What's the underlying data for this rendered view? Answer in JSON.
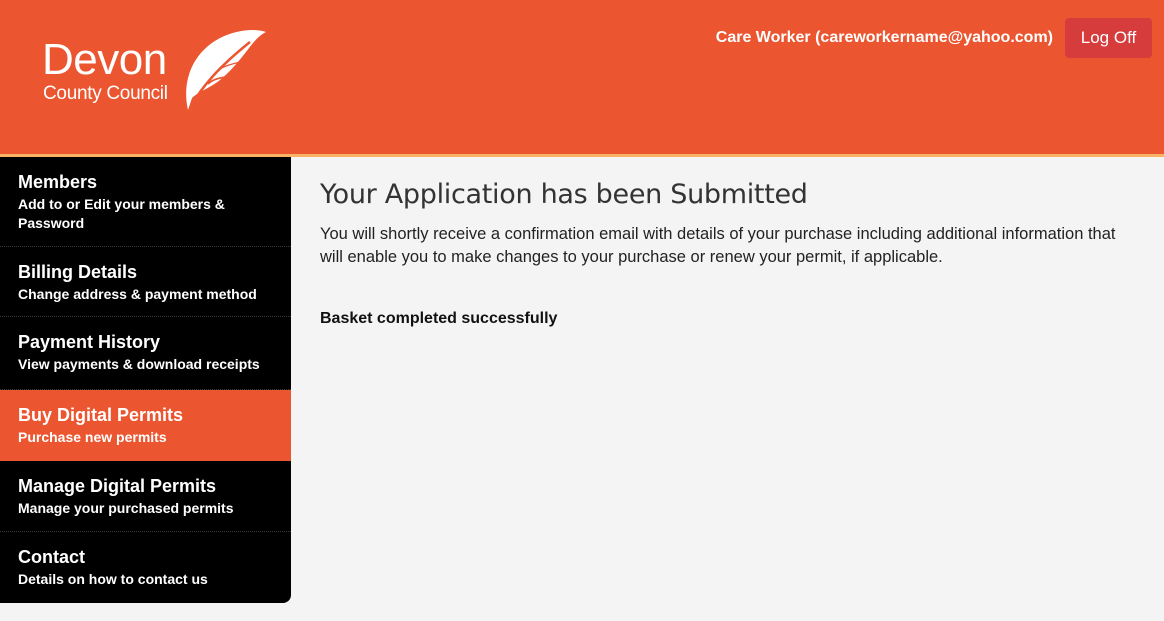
{
  "header": {
    "logo": {
      "word": "Devon",
      "sub": "County Council"
    },
    "user_label": "Care Worker (careworkername@yahoo.com)",
    "logoff_label": "Log Off",
    "colors": {
      "brand_orange": "#eb552f",
      "accent_stripe": "#f7b266",
      "logoff_red": "#d63c3c"
    }
  },
  "sidebar": {
    "items": [
      {
        "title": "Members",
        "subtitle": "Add to or Edit your members & Password",
        "active": false
      },
      {
        "title": "Billing Details",
        "subtitle": "Change address & payment method",
        "active": false
      },
      {
        "title": "Payment History",
        "subtitle": "View payments & download receipts",
        "active": false
      },
      {
        "title": "Buy Digital Permits",
        "subtitle": "Purchase new permits",
        "active": true
      },
      {
        "title": "Manage Digital Permits",
        "subtitle": "Manage your purchased permits",
        "active": false
      },
      {
        "title": "Contact",
        "subtitle": "Details on how to contact us",
        "active": false
      }
    ]
  },
  "main": {
    "title": "Your Application has been Submitted",
    "description": "You will shortly receive a confirmation email with details of your purchase including additional information that will enable you to make changes to your purchase or renew your permit, if applicable.",
    "status": "Basket completed successfully"
  }
}
